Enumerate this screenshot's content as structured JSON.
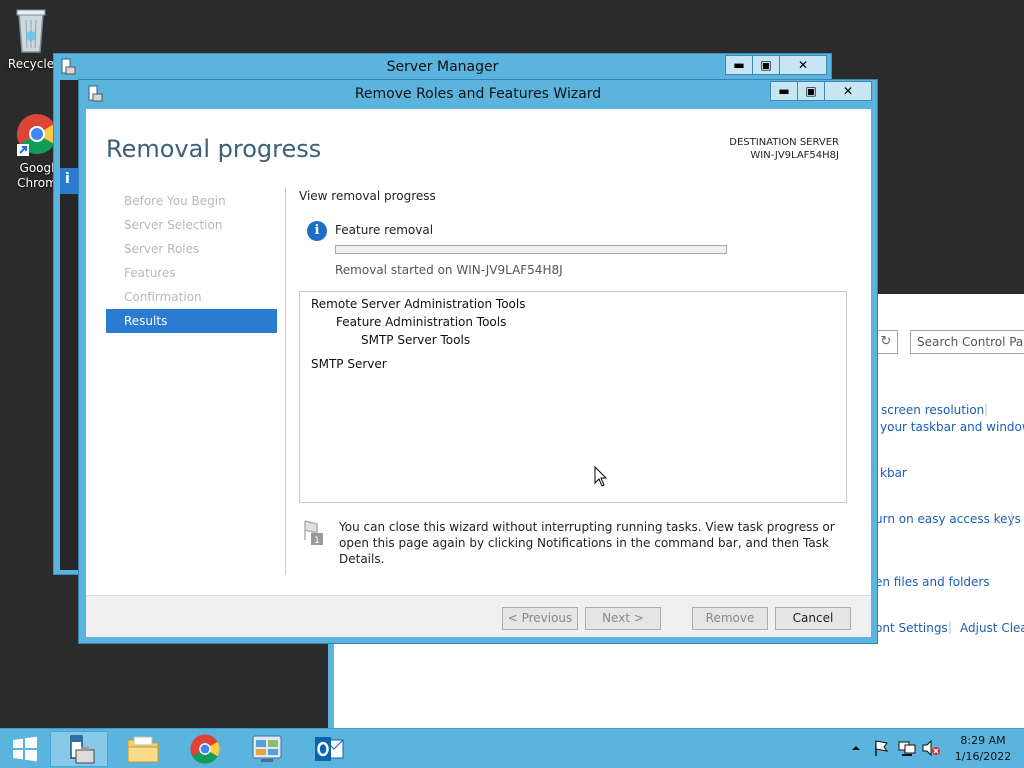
{
  "desktop": {
    "icons": [
      {
        "label": "Recycle"
      },
      {
        "label_line1": "Googl",
        "label_line2": "Chrom"
      }
    ]
  },
  "server_manager": {
    "title": "Server Manager"
  },
  "control_panel": {
    "search_placeholder": "Search Control Panel",
    "links": [
      "screen resolution",
      "your taskbar and window b",
      "kbar",
      "urn on easy access keys",
      "en files and folders",
      "ont Settings",
      "Adjust Clear"
    ]
  },
  "wizard": {
    "title": "Remove Roles and Features Wizard",
    "heading": "Removal progress",
    "destination_label": "DESTINATION SERVER",
    "destination_server": "WIN-JV9LAF54H8J",
    "steps": [
      {
        "label": "Before You Begin",
        "active": false
      },
      {
        "label": "Server Selection",
        "active": false
      },
      {
        "label": "Server Roles",
        "active": false
      },
      {
        "label": "Features",
        "active": false
      },
      {
        "label": "Confirmation",
        "active": false
      },
      {
        "label": "Results",
        "active": true
      }
    ],
    "sub_heading": "View removal progress",
    "progress": {
      "label": "Feature removal",
      "value": 0,
      "status": "Removal started on WIN-JV9LAF54H8J"
    },
    "results": [
      {
        "text": "Remote Server Administration Tools",
        "level": 0
      },
      {
        "text": "Feature Administration Tools",
        "level": 1
      },
      {
        "text": "SMTP Server Tools",
        "level": 2
      },
      {
        "text": "SMTP Server",
        "level": 0
      }
    ],
    "note": {
      "text": "You can close this wizard without interrupting running tasks. View task progress or open this page again by clicking Notifications in the command bar, and then Task Details.",
      "badge": "1"
    },
    "buttons": {
      "previous": "< Previous",
      "next": "Next >",
      "remove": "Remove",
      "cancel": "Cancel"
    }
  },
  "taskbar": {
    "time": "8:29 AM",
    "date": "1/16/2022"
  },
  "colors": {
    "chrome_blue": "#5ab4dd",
    "accent": "#2b7bd0"
  }
}
